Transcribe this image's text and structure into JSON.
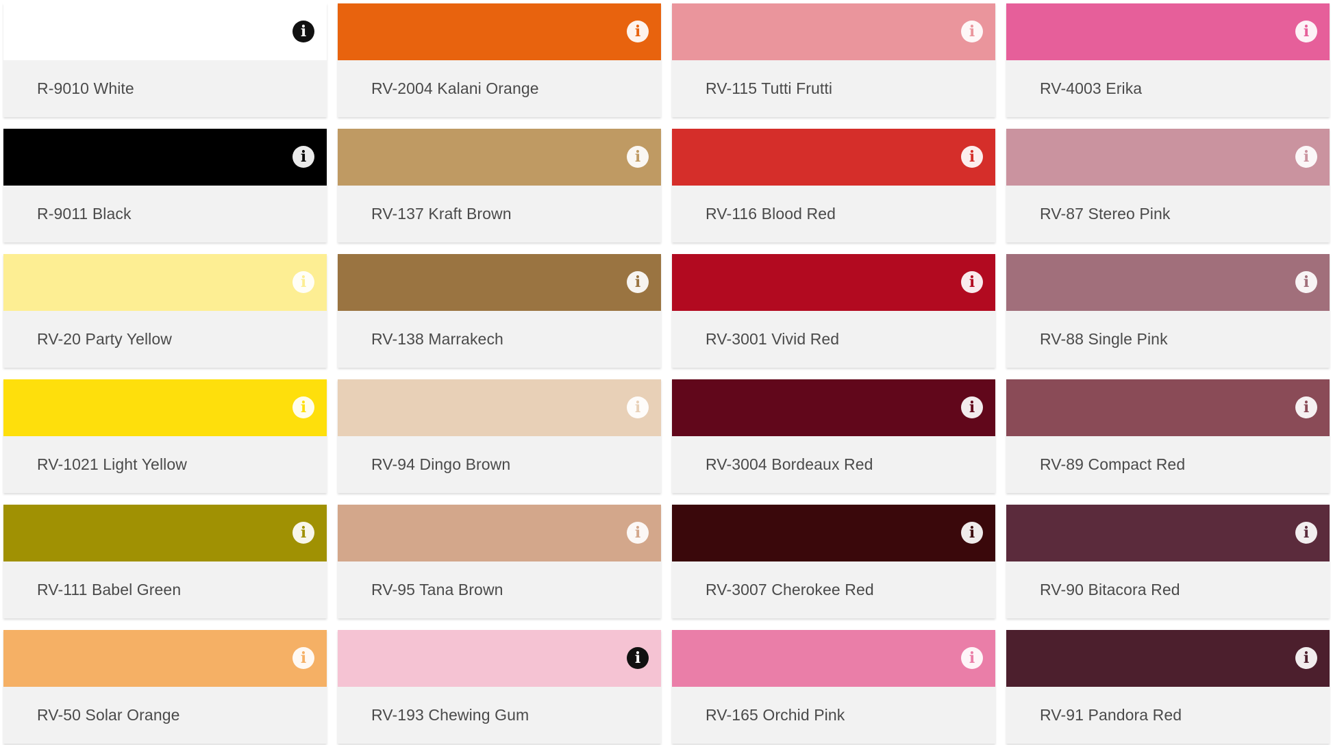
{
  "info_glyph": "i",
  "colors": [
    {
      "name": "R-9010 White",
      "hex": "#ffffff",
      "icon": "dark"
    },
    {
      "name": "RV-2004 Kalani Orange",
      "hex": "#e8630e",
      "icon": "light"
    },
    {
      "name": "RV-115 Tutti Frutti",
      "hex": "#ea959c",
      "icon": "light"
    },
    {
      "name": "RV-4003 Erika",
      "hex": "#e65f9a",
      "icon": "light"
    },
    {
      "name": "R-9011 Black",
      "hex": "#000000",
      "icon": "light"
    },
    {
      "name": "RV-137 Kraft Brown",
      "hex": "#bf9a63",
      "icon": "light"
    },
    {
      "name": "RV-116 Blood Red",
      "hex": "#d52e2a",
      "icon": "light"
    },
    {
      "name": "RV-87 Stereo Pink",
      "hex": "#ca939f",
      "icon": "light"
    },
    {
      "name": "RV-20 Party Yellow",
      "hex": "#fdee93",
      "icon": "light"
    },
    {
      "name": "RV-138 Marrakech",
      "hex": "#9a7441",
      "icon": "light"
    },
    {
      "name": "RV-3001 Vivid Red",
      "hex": "#b20a20",
      "icon": "light"
    },
    {
      "name": "RV-88 Single Pink",
      "hex": "#a16f7b",
      "icon": "light"
    },
    {
      "name": "RV-1021 Light Yellow",
      "hex": "#fedf0c",
      "icon": "light"
    },
    {
      "name": "RV-94 Dingo Brown",
      "hex": "#e8d0b7",
      "icon": "light"
    },
    {
      "name": "RV-3004 Bordeaux Red",
      "hex": "#61071b",
      "icon": "light"
    },
    {
      "name": "RV-89 Compact Red",
      "hex": "#8a4b57",
      "icon": "light"
    },
    {
      "name": "RV-111 Babel Green",
      "hex": "#a09103",
      "icon": "light"
    },
    {
      "name": "RV-95 Tana Brown",
      "hex": "#d3a78b",
      "icon": "light"
    },
    {
      "name": "RV-3007 Cherokee Red",
      "hex": "#3a080b",
      "icon": "light"
    },
    {
      "name": "RV-90 Bitacora Red",
      "hex": "#5b2b3c",
      "icon": "light"
    },
    {
      "name": "RV-50 Solar Orange",
      "hex": "#f5b065",
      "icon": "light"
    },
    {
      "name": "RV-193 Chewing Gum",
      "hex": "#f5c3d3",
      "icon": "dark"
    },
    {
      "name": "RV-165 Orchid Pink",
      "hex": "#ea7ea8",
      "icon": "light"
    },
    {
      "name": "RV-91 Pandora Red",
      "hex": "#4c1f2d",
      "icon": "light"
    }
  ]
}
